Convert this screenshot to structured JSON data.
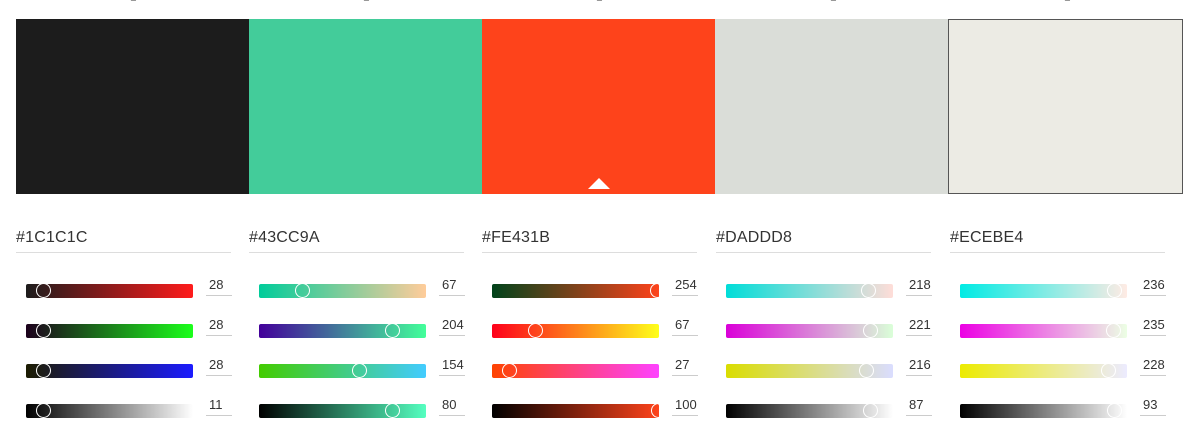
{
  "palette": [
    {
      "hex": "#1C1C1C",
      "color": "#1C1C1C",
      "channels": [
        {
          "value": 28,
          "gradient": [
            "#1C1C1C",
            "#FF1C1C"
          ]
        },
        {
          "value": 28,
          "gradient": [
            "#1C001C",
            "#1CFF1C"
          ]
        },
        {
          "value": 28,
          "gradient": [
            "#1C1C00",
            "#1C1CFF"
          ]
        },
        {
          "value": 11,
          "gradient": [
            "#000000",
            "#FFFFFF"
          ]
        }
      ]
    },
    {
      "hex": "#43CC9A",
      "color": "#43CC9A",
      "channels": [
        {
          "value": 67,
          "gradient": [
            "#00CC9A",
            "#FFCC9A"
          ]
        },
        {
          "value": 204,
          "gradient": [
            "#43009A",
            "#43FF9A"
          ]
        },
        {
          "value": 154,
          "gradient": [
            "#43CC00",
            "#43CCFF"
          ]
        },
        {
          "value": 80,
          "gradient": [
            "#000000",
            "#55FFC0"
          ]
        }
      ]
    },
    {
      "hex": "#FE431B",
      "color": "#FE431B",
      "channels": [
        {
          "value": 254,
          "gradient": [
            "#00431B",
            "#FE431B"
          ]
        },
        {
          "value": 67,
          "gradient": [
            "#FE001B",
            "#FEFF1B"
          ]
        },
        {
          "value": 27,
          "gradient": [
            "#FE4300",
            "#FE43FF"
          ]
        },
        {
          "value": 100,
          "gradient": [
            "#000000",
            "#FE431B"
          ]
        }
      ]
    },
    {
      "hex": "#DADDD8",
      "color": "#DADDD8",
      "channels": [
        {
          "value": 218,
          "gradient": [
            "#00DDD8",
            "#FFDDD8"
          ]
        },
        {
          "value": 221,
          "gradient": [
            "#DA00D8",
            "#DAFFD8"
          ]
        },
        {
          "value": 216,
          "gradient": [
            "#DADD00",
            "#DADDFF"
          ]
        },
        {
          "value": 87,
          "gradient": [
            "#000000",
            "#FFFFFF"
          ]
        }
      ]
    },
    {
      "hex": "#ECEBE4",
      "color": "#ECEBE4",
      "channels": [
        {
          "value": 236,
          "gradient": [
            "#00EBE4",
            "#FFEBE4"
          ]
        },
        {
          "value": 235,
          "gradient": [
            "#EC00E4",
            "#ECFFE4"
          ]
        },
        {
          "value": 228,
          "gradient": [
            "#ECEB00",
            "#ECEBFF"
          ]
        },
        {
          "value": 93,
          "gradient": [
            "#000000",
            "#FFFFFF"
          ]
        }
      ]
    }
  ],
  "selected_index": 2,
  "channel_max": [
    255,
    255,
    255,
    100
  ]
}
